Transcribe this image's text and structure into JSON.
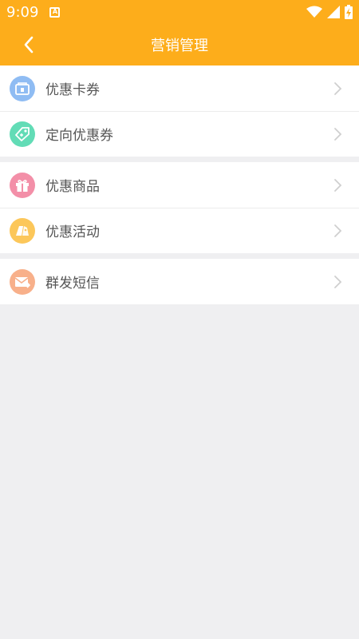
{
  "status_bar": {
    "time": "9:09",
    "notification_letter": "A"
  },
  "header": {
    "title": "营销管理"
  },
  "menu_groups": [
    {
      "items": [
        {
          "label": "优惠卡券",
          "icon": "coupon-card-icon",
          "color": "#8fbcf3"
        },
        {
          "label": "定向优惠券",
          "icon": "tag-icon",
          "color": "#62dcb6"
        }
      ]
    },
    {
      "items": [
        {
          "label": "优惠商品",
          "icon": "gift-icon",
          "color": "#f38fa8"
        },
        {
          "label": "优惠活动",
          "icon": "activity-tag-icon",
          "color": "#fcc75a"
        }
      ]
    },
    {
      "items": [
        {
          "label": "群发短信",
          "icon": "sms-mail-icon",
          "color": "#f8b08a"
        }
      ]
    }
  ],
  "colors": {
    "accent": "#fdad1b",
    "background": "#efeff1"
  }
}
